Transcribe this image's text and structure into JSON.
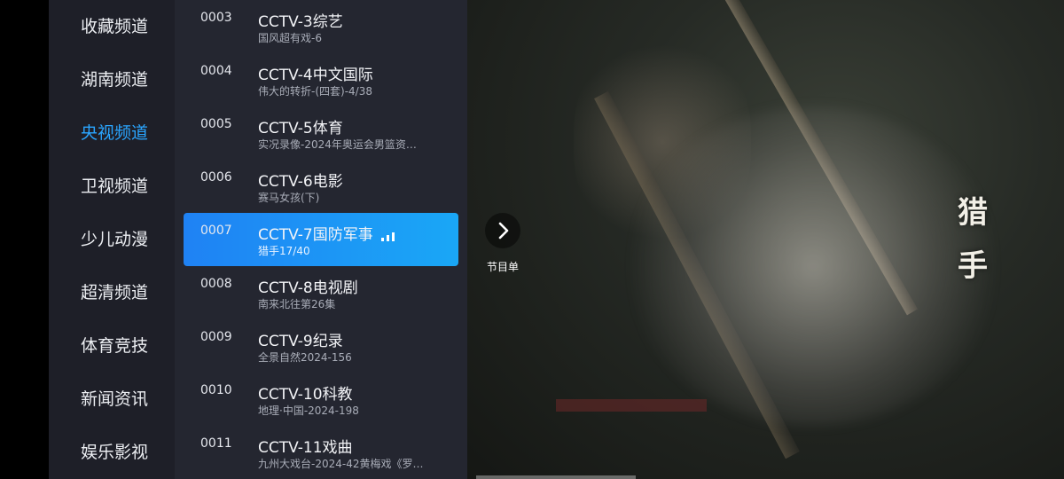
{
  "categories": [
    {
      "label": "收藏频道",
      "active": false
    },
    {
      "label": "湖南频道",
      "active": false
    },
    {
      "label": "央视频道",
      "active": true
    },
    {
      "label": "卫视频道",
      "active": false
    },
    {
      "label": "少儿动漫",
      "active": false
    },
    {
      "label": "超清频道",
      "active": false
    },
    {
      "label": "体育竞技",
      "active": false
    },
    {
      "label": "新闻资讯",
      "active": false
    },
    {
      "label": "娱乐影视",
      "active": false
    }
  ],
  "channels": [
    {
      "number": "0003",
      "name": "CCTV-3综艺",
      "program": "国风超有戏-6"
    },
    {
      "number": "0004",
      "name": "CCTV-4中文国际",
      "program": "伟大的转折-(四套)-4/38"
    },
    {
      "number": "0005",
      "name": "CCTV-5体育",
      "program": "实况录像-2024年奥运会男篮资…"
    },
    {
      "number": "0006",
      "name": "CCTV-6电影",
      "program": "赛马女孩(下)"
    },
    {
      "number": "0007",
      "name": "CCTV-7国防军事",
      "program": "猎手17/40",
      "selected": true,
      "playing": true
    },
    {
      "number": "0008",
      "name": "CCTV-8电视剧",
      "program": "南来北往第26集"
    },
    {
      "number": "0009",
      "name": "CCTV-9纪录",
      "program": "全景自然2024-156"
    },
    {
      "number": "0010",
      "name": "CCTV-10科教",
      "program": "地理·中国-2024-198"
    },
    {
      "number": "0011",
      "name": "CCTV-11戏曲",
      "program": "九州大戏台-2024-42黄梅戏《罗…"
    }
  ],
  "epg_button": {
    "label": "节目单",
    "icon": "chevron-right-icon"
  },
  "video": {
    "title_watermark": "猎 手"
  },
  "colors": {
    "accent": "#2aa5ff",
    "selected_row": "#1f82f4"
  }
}
